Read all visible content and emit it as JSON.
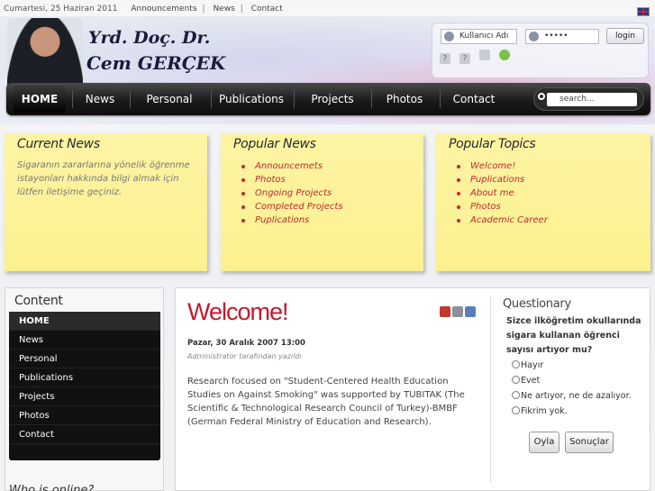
{
  "topbar": {
    "date": "Cumartesi, 25 Haziran 2011",
    "links": [
      "Announcements",
      "News",
      "Contact"
    ]
  },
  "header": {
    "logo_line1": "Yrd. Doç. Dr.",
    "logo_line2": "Cem GERÇEK"
  },
  "login": {
    "username": "Kullanıcı Adı",
    "password": "•••••",
    "button": "login"
  },
  "nav": {
    "items": [
      "HOME",
      "News",
      "Personal",
      "Publications",
      "Projects",
      "Photos",
      "Contact"
    ],
    "search_placeholder": "search..."
  },
  "current_news": {
    "title": "Current News",
    "text": "Sigaranın zararlarına yönelik öğrenme istayonları hakkında bilgi almak için lütfen iletişime geçiniz."
  },
  "popular_news": {
    "title": "Popular News",
    "items": [
      "Announcemets",
      "Photos",
      "Ongoing Projects",
      "Completed Projects",
      "Puplications"
    ]
  },
  "popular_topics": {
    "title": "Popular Topics",
    "items": [
      "Welcome!",
      "Puplications",
      "About me",
      "Photos",
      "Academic Career"
    ]
  },
  "sidebar": {
    "title": "Content",
    "items": [
      "HOME",
      "News",
      "Personal",
      "Publications",
      "Projects",
      "Photos",
      "Contact"
    ],
    "who_online": "Who is online?"
  },
  "article": {
    "title": "Welcome!",
    "date": "Pazar, 30 Aralık 2007 13:00",
    "author": "Administrator tarafından yazıldı",
    "body": "Research focused on \"Student-Centered Health Education Studies on Against Smoking\" was supported by TUBITAK (The Scientific & Technological Research Council of Turkey)-BMBF (German Federal Ministry of Education and Research)."
  },
  "poll": {
    "title": "Questionary",
    "question": "Sizce ilköğretim okullarında sigara kullanan öğrenci sayısı artıyor mu?",
    "options": [
      "Hayır",
      "Evet",
      "Ne artıyor, ne de azalıyor.",
      "Fikrim yok."
    ],
    "vote": "Oyla",
    "results": "Sonuçlar"
  },
  "colors": {
    "accent": "#c7172c",
    "note": "#fdf4a4",
    "nav": "#111111"
  }
}
